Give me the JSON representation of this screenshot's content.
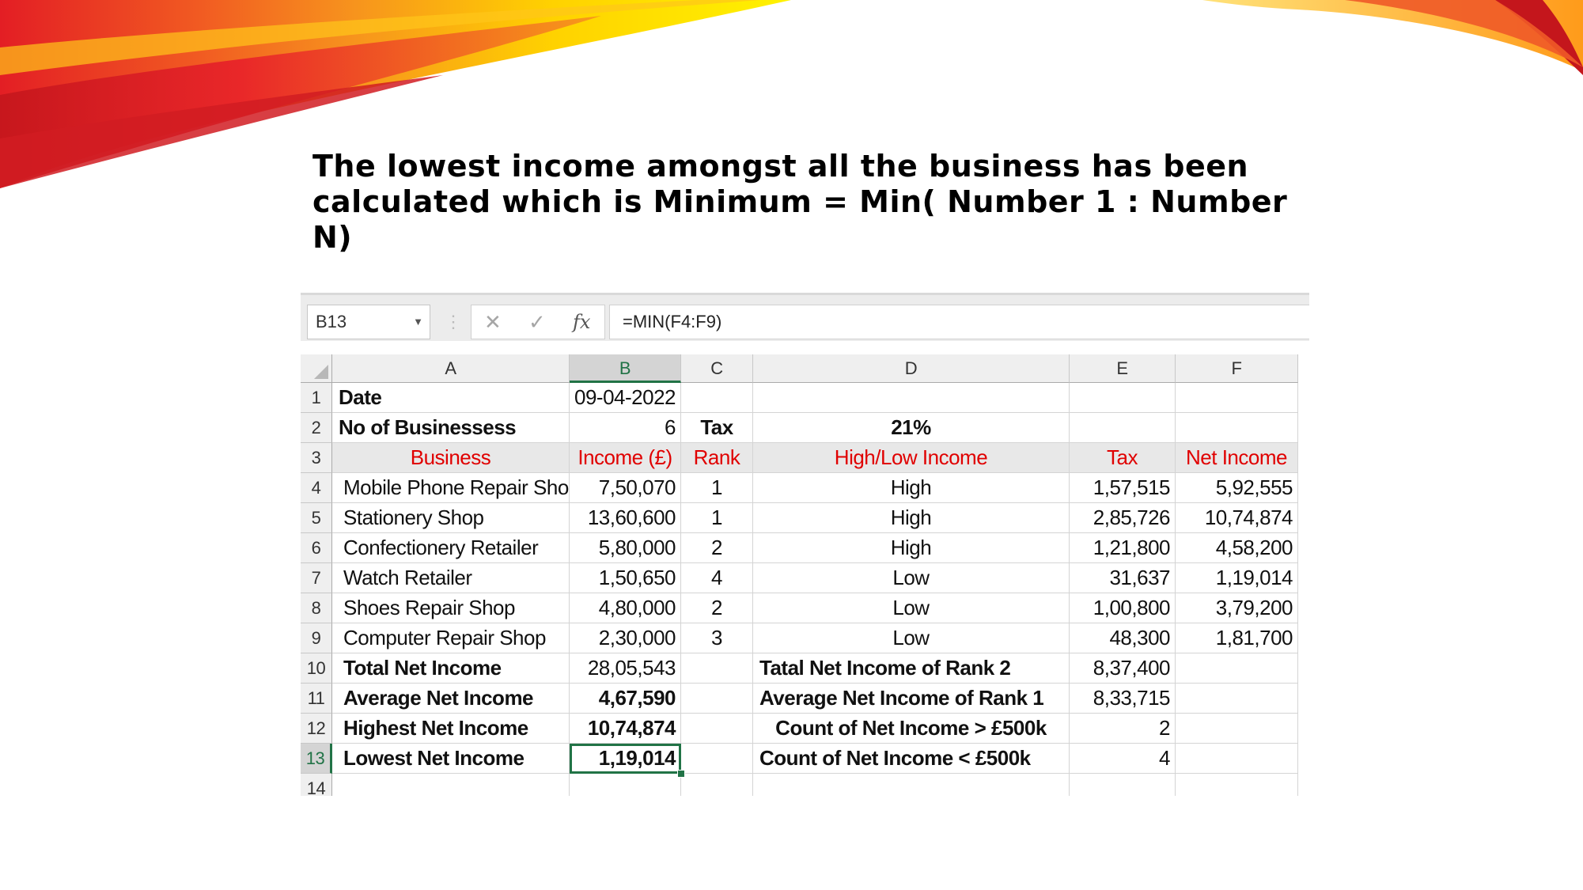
{
  "slide": {
    "title": "The lowest income amongst all the business has been calculated which is Minimum = Min( Number 1 : Number N)",
    "colors": {
      "swoosh_red": "#e8202a",
      "swoosh_orange": "#f7941d",
      "swoosh_yellow": "#ffd200"
    }
  },
  "excel": {
    "name_box": "B13",
    "name_box_dropdown_icon": "chevron-down-icon",
    "cancel_icon": "close-icon",
    "enter_icon": "check-icon",
    "function_icon": "fx",
    "formula": "=MIN(F4:F9)",
    "accent_color": "#217346",
    "columns": [
      "A",
      "B",
      "C",
      "D",
      "E",
      "F"
    ],
    "row_numbers": [
      "1",
      "2",
      "3",
      "4",
      "5",
      "6",
      "7",
      "8",
      "9",
      "10",
      "11",
      "12",
      "13",
      "14"
    ],
    "rows": [
      [
        "Date",
        "09-04-2022",
        "",
        "",
        "",
        ""
      ],
      [
        "No of Businessess",
        "6",
        "Tax",
        "21%",
        "",
        ""
      ],
      [
        "Business",
        "Income (£)",
        "Rank",
        "High/Low Income",
        "Tax",
        "Net Income"
      ],
      [
        "Mobile Phone Repair Shop",
        "7,50,070",
        "1",
        "High",
        "1,57,515",
        "5,92,555"
      ],
      [
        "Stationery Shop",
        "13,60,600",
        "1",
        "High",
        "2,85,726",
        "10,74,874"
      ],
      [
        "Confectionery Retailer",
        "5,80,000",
        "2",
        "High",
        "1,21,800",
        "4,58,200"
      ],
      [
        "Watch Retailer",
        "1,50,650",
        "4",
        "Low",
        "31,637",
        "1,19,014"
      ],
      [
        "Shoes Repair Shop",
        "4,80,000",
        "2",
        "Low",
        "1,00,800",
        "3,79,200"
      ],
      [
        "Computer Repair Shop",
        "2,30,000",
        "3",
        "Low",
        "48,300",
        "1,81,700"
      ],
      [
        "Total Net Income",
        "28,05,543",
        "",
        "Tatal Net Income of Rank 2",
        "8,37,400",
        ""
      ],
      [
        "Average Net Income",
        "4,67,590",
        "",
        "Average Net Income of Rank 1",
        "8,33,715",
        ""
      ],
      [
        "Highest Net Income",
        "10,74,874",
        "",
        "Count of Net Income > £500k",
        "2",
        ""
      ],
      [
        "Lowest Net Income",
        "1,19,014",
        "",
        "Count of Net Income < £500k",
        "4",
        ""
      ],
      [
        "",
        "",
        "",
        "",
        "",
        ""
      ]
    ]
  }
}
